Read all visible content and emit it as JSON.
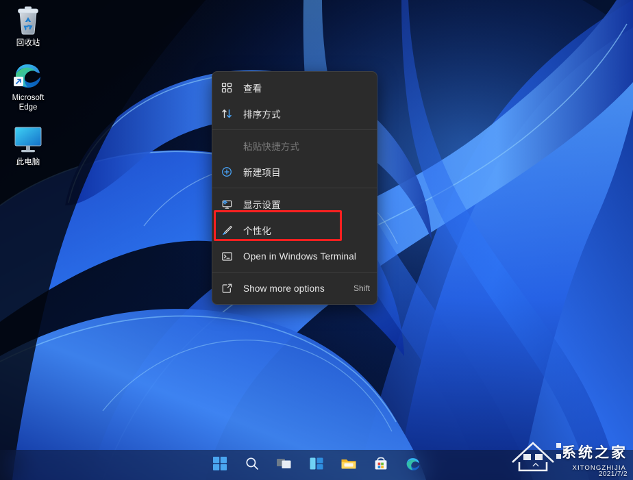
{
  "desktop": {
    "icons": [
      {
        "label": "回收站",
        "icon": "recycle-bin-icon",
        "name": "recycle-bin"
      },
      {
        "label": "Microsoft Edge",
        "icon": "edge-browser-icon",
        "name": "microsoft-edge"
      },
      {
        "label": "此电脑",
        "icon": "this-pc-monitor-icon",
        "name": "this-pc"
      }
    ],
    "wallpaper_name": "windows-11-bloom-blue",
    "wallpaper_colors": {
      "background_dark": "#04091a",
      "ribbon_deep": "#0b2a8c",
      "ribbon_mid": "#1d5ce8",
      "ribbon_light": "#4f9bff",
      "ribbon_glow": "#7fc4ff"
    }
  },
  "context_menu": {
    "items": [
      {
        "label": "查看",
        "icon": "view-grid-icon",
        "accel": "",
        "disabled": false,
        "highlighted": false
      },
      {
        "label": "排序方式",
        "icon": "sort-arrows-icon",
        "accel": "",
        "disabled": false,
        "highlighted": false
      },
      {
        "separator_after": true
      },
      {
        "label": "粘贴快捷方式",
        "icon": "",
        "accel": "",
        "disabled": true,
        "highlighted": false
      },
      {
        "label": "新建项目",
        "icon": "new-item-plus-icon",
        "accel": "",
        "disabled": false,
        "highlighted": false
      },
      {
        "separator_after": true
      },
      {
        "label": "显示设置",
        "icon": "display-settings-monitor-icon",
        "accel": "",
        "disabled": false,
        "highlighted": false
      },
      {
        "label": "个性化",
        "icon": "personalize-brush-icon",
        "accel": "",
        "disabled": false,
        "highlighted": true
      },
      {
        "label": "Open in Windows Terminal",
        "icon": "terminal-icon",
        "accel": "",
        "disabled": false,
        "highlighted": false
      },
      {
        "separator_after": true
      },
      {
        "label": "Show more options",
        "icon": "show-more-options-icon",
        "accel": "Shift",
        "disabled": false,
        "highlighted": false
      }
    ],
    "background_color": "#2b2b2b",
    "border_color": "#404040",
    "text_color": "#e8e8e8",
    "disabled_text_color": "#7a7a7a"
  },
  "annotation": {
    "target_label": "个性化",
    "color": "#ff2020"
  },
  "taskbar": {
    "buttons": [
      {
        "name": "start-button",
        "icon": "windows-logo-icon",
        "label": "开始"
      },
      {
        "name": "search-button",
        "icon": "search-icon",
        "label": "搜索"
      },
      {
        "name": "task-view-button",
        "icon": "task-view-icon",
        "label": "任务视图"
      },
      {
        "name": "widgets-button",
        "icon": "widgets-icon",
        "label": "小组件"
      },
      {
        "name": "file-explorer-button",
        "icon": "folder-icon",
        "label": "文件资源管理器"
      },
      {
        "name": "microsoft-store-button",
        "icon": "store-bag-icon",
        "label": "Microsoft Store"
      },
      {
        "name": "edge-button",
        "icon": "edge-browser-icon",
        "label": "Microsoft Edge"
      }
    ],
    "tray": {
      "overflow_icon": "chevron-up-icon"
    }
  },
  "watermark": {
    "title": "系统之家",
    "subtitle": "XITONGZHIJIA",
    "date": "2021/7/2"
  }
}
